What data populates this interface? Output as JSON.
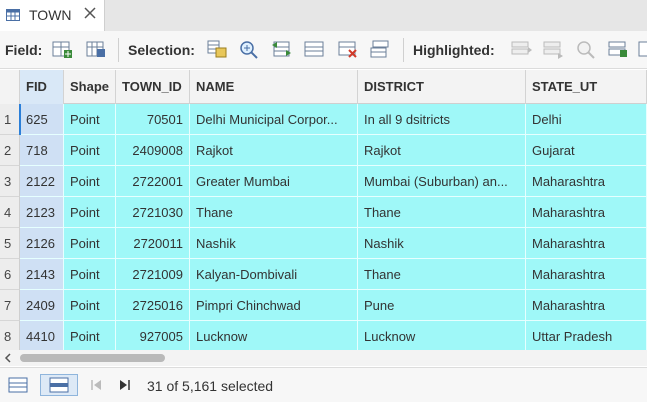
{
  "tab": {
    "title": "TOWN",
    "icon": "table-icon",
    "close_icon": "close-icon"
  },
  "toolbar": {
    "field_label": "Field:",
    "selection_label": "Selection:",
    "highlighted_label": "Highlighted:",
    "field_buttons": [
      "add-field-icon",
      "calculate-field-icon"
    ],
    "selection_buttons": [
      "select-by-attributes-icon",
      "zoom-to-selection-icon",
      "switch-selection-icon",
      "select-all-icon",
      "clear-selection-icon",
      "delete-selection-icon"
    ],
    "highlighted_buttons": [
      "highlight-switch-icon",
      "highlight-clear-icon",
      "zoom-to-highlighted-icon",
      "highlight-copy-icon",
      "highlight-more-icon"
    ]
  },
  "table": {
    "columns": [
      "FID",
      "Shape",
      "TOWN_ID",
      "NAME",
      "DISTRICT",
      "STATE_UT"
    ],
    "rows": [
      {
        "n": "1",
        "fid": "625",
        "shape": "Point",
        "town_id": "70501",
        "name": "Delhi Municipal Corpor...",
        "district": "In all 9 dsitricts",
        "state": "Delhi"
      },
      {
        "n": "2",
        "fid": "718",
        "shape": "Point",
        "town_id": "2409008",
        "name": "Rajkot",
        "district": "Rajkot",
        "state": "Gujarat"
      },
      {
        "n": "3",
        "fid": "2122",
        "shape": "Point",
        "town_id": "2722001",
        "name": "Greater Mumbai",
        "district": "Mumbai (Suburban) an...",
        "state": "Maharashtra"
      },
      {
        "n": "4",
        "fid": "2123",
        "shape": "Point",
        "town_id": "2721030",
        "name": "Thane",
        "district": "Thane",
        "state": "Maharashtra"
      },
      {
        "n": "5",
        "fid": "2126",
        "shape": "Point",
        "town_id": "2720011",
        "name": "Nashik",
        "district": "Nashik",
        "state": "Maharashtra"
      },
      {
        "n": "6",
        "fid": "2143",
        "shape": "Point",
        "town_id": "2721009",
        "name": "Kalyan-Dombivali",
        "district": "Thane",
        "state": "Maharashtra"
      },
      {
        "n": "7",
        "fid": "2409",
        "shape": "Point",
        "town_id": "2725016",
        "name": "Pimpri Chinchwad",
        "district": "Pune",
        "state": "Maharashtra"
      },
      {
        "n": "8",
        "fid": "4410",
        "shape": "Point",
        "town_id": "927005",
        "name": "Lucknow",
        "district": "Lucknow",
        "state": "Uttar Pradesh"
      }
    ]
  },
  "status": {
    "text": "31 of 5,161 selected",
    "buttons": [
      "show-all-records-icon",
      "show-selected-records-icon",
      "first-record-icon",
      "last-record-icon"
    ]
  },
  "colors": {
    "selected_row": "#9ff8f8",
    "accent": "#2b7fd8"
  }
}
